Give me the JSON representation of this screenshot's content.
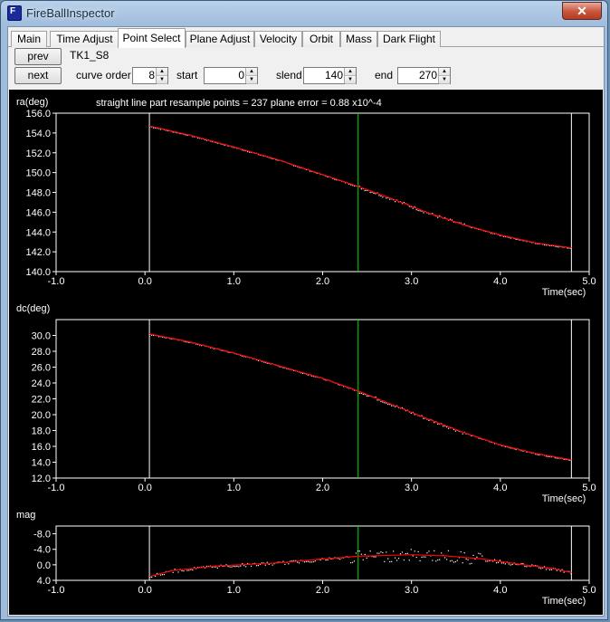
{
  "window": {
    "title": "FireBallInspector",
    "close_label": "✕"
  },
  "tabs": [
    {
      "label": "Main",
      "active": false
    },
    {
      "label": "Time Adjust",
      "active": false
    },
    {
      "label": "Point Select",
      "active": true
    },
    {
      "label": "Plane Adjust",
      "active": false
    },
    {
      "label": "Velocity",
      "active": false
    },
    {
      "label": "Orbit",
      "active": false
    },
    {
      "label": "Mass",
      "active": false
    },
    {
      "label": "Dark Flight",
      "active": false
    }
  ],
  "controls": {
    "prev_label": "prev",
    "next_label": "next",
    "track_name": "TK1_S8",
    "curve_order": {
      "label": "curve order",
      "value": "8"
    },
    "start": {
      "label": "start",
      "value": "0"
    },
    "slend": {
      "label": "slend",
      "value": "140"
    },
    "end": {
      "label": "end",
      "value": "270"
    }
  },
  "info_text": "straight line part resample points = 237  plane error = 0.88 x10^-4",
  "colors": {
    "fit": "#ff0000",
    "marker": "#00e000",
    "points": "#ffffff",
    "frame": "#ffffff"
  },
  "markers": {
    "start_time": 0.05,
    "slend_time": 2.4,
    "end_time": 4.8
  },
  "chart_data": [
    {
      "type": "scatter",
      "ylabel": "ra(deg)",
      "xlabel": "Time(sec)",
      "xlim": [
        -1.0,
        5.0
      ],
      "ylim": [
        140.0,
        156.0
      ],
      "x_ticks": [
        "-1.0",
        "0.0",
        "1.0",
        "2.0",
        "3.0",
        "4.0",
        "5.0"
      ],
      "y_ticks": [
        "156.0",
        "154.0",
        "152.0",
        "150.0",
        "148.0",
        "146.0",
        "144.0",
        "142.0",
        "140.0"
      ],
      "fit": [
        [
          0.05,
          154.7
        ],
        [
          0.5,
          153.8
        ],
        [
          1.0,
          152.6
        ],
        [
          1.5,
          151.3
        ],
        [
          2.0,
          149.8
        ],
        [
          2.4,
          148.6
        ],
        [
          2.8,
          147.3
        ],
        [
          3.2,
          145.9
        ],
        [
          3.6,
          144.7
        ],
        [
          4.0,
          143.7
        ],
        [
          4.4,
          142.9
        ],
        [
          4.8,
          142.4
        ]
      ]
    },
    {
      "type": "scatter",
      "ylabel": "dc(deg)",
      "xlabel": "Time(sec)",
      "xlim": [
        -1.0,
        5.0
      ],
      "ylim": [
        12.0,
        32.0
      ],
      "x_ticks": [
        "-1.0",
        "0.0",
        "1.0",
        "2.0",
        "3.0",
        "4.0",
        "5.0"
      ],
      "y_ticks": [
        "30.0",
        "28.0",
        "26.0",
        "24.0",
        "22.0",
        "20.0",
        "18.0",
        "16.0",
        "14.0",
        "12.0"
      ],
      "fit": [
        [
          0.05,
          30.2
        ],
        [
          0.5,
          29.2
        ],
        [
          1.0,
          27.8
        ],
        [
          1.5,
          26.2
        ],
        [
          2.0,
          24.6
        ],
        [
          2.4,
          23.0
        ],
        [
          2.8,
          21.2
        ],
        [
          3.2,
          19.4
        ],
        [
          3.6,
          17.7
        ],
        [
          4.0,
          16.2
        ],
        [
          4.4,
          15.1
        ],
        [
          4.8,
          14.3
        ]
      ]
    },
    {
      "type": "scatter",
      "ylabel": "mag",
      "xlabel": "Time(sec)",
      "xlim": [
        -1.0,
        5.0
      ],
      "ylim": [
        4.0,
        -10.0
      ],
      "x_ticks": [
        "-1.0",
        "0.0",
        "1.0",
        "2.0",
        "3.0",
        "4.0",
        "5.0"
      ],
      "y_ticks": [
        "-8.0",
        "-4.0",
        "0.0",
        "4.0"
      ],
      "fit": [
        [
          0.05,
          3.0
        ],
        [
          0.3,
          1.5
        ],
        [
          0.8,
          0.3
        ],
        [
          1.5,
          -0.5
        ],
        [
          2.0,
          -1.5
        ],
        [
          2.4,
          -2.2
        ],
        [
          3.0,
          -2.6
        ],
        [
          3.4,
          -2.3
        ],
        [
          3.8,
          -1.5
        ],
        [
          4.2,
          -0.2
        ],
        [
          4.6,
          1.0
        ],
        [
          4.8,
          2.0
        ]
      ]
    }
  ]
}
